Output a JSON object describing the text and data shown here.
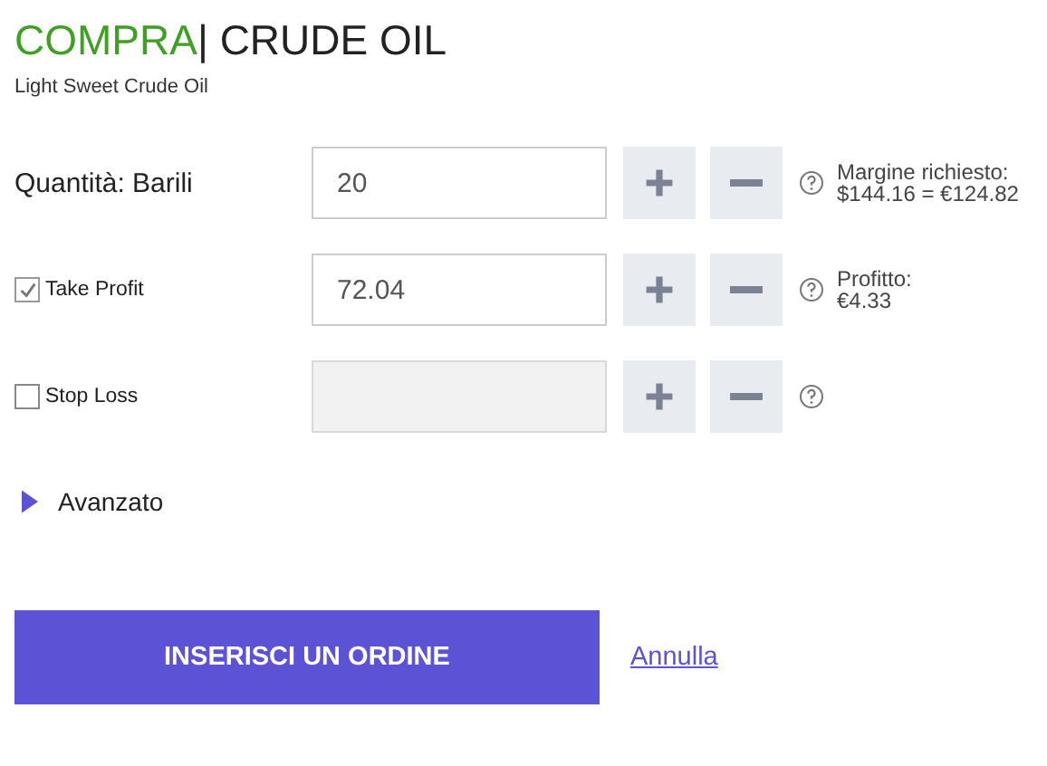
{
  "header": {
    "action": "COMPRA",
    "instrument": "| CRUDE OIL",
    "subtitle": "Light Sweet Crude Oil"
  },
  "rows": [
    {
      "kind": "label",
      "label": "Quantità: Barili",
      "value": "20",
      "disabled": false,
      "info": [
        "Margine richiesto:",
        "$144.16 = €124.82"
      ]
    },
    {
      "kind": "checkbox",
      "label": "Take Profit",
      "checked": true,
      "value": "72.04",
      "disabled": false,
      "info": [
        "Profitto:",
        "€4.33"
      ]
    },
    {
      "kind": "checkbox",
      "label": "Stop Loss",
      "checked": false,
      "disabled": true,
      "info": []
    }
  ],
  "advanced": {
    "label": "Avanzato",
    "expanded": false
  },
  "submit": "INSERISCI UN ORDINE",
  "cancel": "Annulla"
}
